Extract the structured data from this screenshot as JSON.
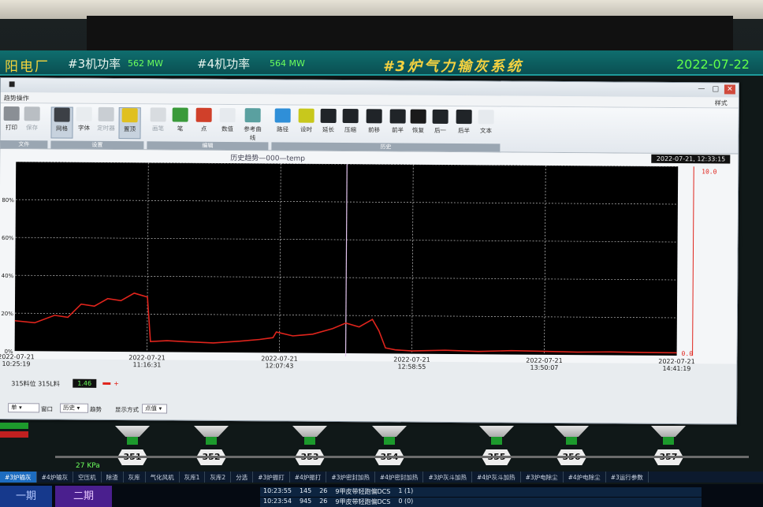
{
  "header": {
    "plant": "阳电厂",
    "unit3_label": "#3机功率",
    "unit3_value": "562 MW",
    "unit4_label": "#4机功率",
    "unit4_value": "564 MW",
    "system_title": "#3炉气力输灰系统",
    "date": "2022-07-22"
  },
  "window": {
    "menu": "趋势操作",
    "style_menu": "样式",
    "ribbon": {
      "buttons": [
        {
          "label": "打印",
          "name": "print",
          "dim": false
        },
        {
          "label": "保存",
          "name": "save",
          "dim": true
        },
        {
          "label": "网格",
          "name": "grid",
          "active": true
        },
        {
          "label": "字体",
          "name": "font"
        },
        {
          "label": "定时器",
          "name": "timer",
          "dim": true
        },
        {
          "label": "置顶",
          "name": "topmost",
          "active": true
        },
        {
          "label": "画笔",
          "name": "pen",
          "dim": true
        },
        {
          "label": "笔",
          "name": "pen2"
        },
        {
          "label": "点",
          "name": "point"
        },
        {
          "label": "数值",
          "name": "value"
        },
        {
          "label": "参考曲线",
          "name": "ref-curve"
        },
        {
          "label": "路径",
          "name": "path"
        },
        {
          "label": "设时",
          "name": "set-time"
        },
        {
          "label": "延长",
          "name": "extend"
        },
        {
          "label": "压缩",
          "name": "compress"
        },
        {
          "label": "前移",
          "name": "move-first"
        },
        {
          "label": "前半",
          "name": "prev-half"
        },
        {
          "label": "恢复",
          "name": "restore"
        },
        {
          "label": "后一",
          "name": "next-one"
        },
        {
          "label": "后半",
          "name": "next-half"
        },
        {
          "label": "文本",
          "name": "text"
        }
      ],
      "groups": [
        "文件",
        "设置",
        "编辑",
        "历史"
      ]
    },
    "chart_title": "历史趋势—000—temp",
    "timestamp": "2022-07-21, 12:33:15",
    "legend_text": "315料位 315L料",
    "legend_value": "1.46",
    "legend_marker": "+",
    "bottom": {
      "sel1": "单",
      "lbl1": "窗口",
      "sel2": "历史",
      "lbl2": "趋势",
      "lbl3": "显示方式",
      "sel3": "点值"
    }
  },
  "chart_data": {
    "type": "line",
    "ylim": [
      0,
      100
    ],
    "y_tick_labels": [
      "0%",
      "20%",
      "40%",
      "60%",
      "80%"
    ],
    "y_right_top": "10.0",
    "y_right_bottom": "0.0",
    "x_ticks": [
      {
        "date": "2022-07-21",
        "time": "10:25:19"
      },
      {
        "date": "2022-07-21",
        "time": "11:16:31"
      },
      {
        "date": "2022-07-21",
        "time": "12:07:43"
      },
      {
        "date": "2022-07-21",
        "time": "12:58:55"
      },
      {
        "date": "2022-07-21",
        "time": "13:50:07"
      },
      {
        "date": "2022-07-21",
        "time": "14:41:19"
      }
    ],
    "series": [
      {
        "color": "#e0241c",
        "x": [
          0,
          0.03,
          0.06,
          0.08,
          0.1,
          0.12,
          0.14,
          0.16,
          0.18,
          0.2,
          0.205,
          0.23,
          0.26,
          0.3,
          0.34,
          0.37,
          0.39,
          0.395,
          0.42,
          0.45,
          0.48,
          0.5,
          0.52,
          0.54,
          0.55,
          0.56,
          0.575,
          0.6,
          0.65,
          0.7,
          0.75,
          0.8,
          0.85,
          0.9,
          0.95,
          1.0
        ],
        "y": [
          16,
          15,
          19,
          18,
          25,
          24,
          28,
          27,
          31,
          29,
          5.5,
          6,
          5.5,
          5,
          6,
          7,
          8,
          11,
          9,
          10,
          13,
          16,
          14,
          18,
          12,
          3,
          2,
          1.5,
          2,
          1.5,
          2,
          1.8,
          1.5,
          1.7,
          1.5,
          1.5
        ]
      }
    ],
    "cursor_x": 0.5
  },
  "process": {
    "hoppers": [
      "351",
      "352",
      "353",
      "354",
      "355",
      "356",
      "357"
    ],
    "pressure": "27 KPa"
  },
  "tabs": [
    "#3炉输灰",
    "#4炉输灰",
    "空压机",
    "除渣",
    "灰库",
    "气化风机",
    "灰库1",
    "灰库2",
    "分选",
    "#3炉振打",
    "#4炉振打",
    "#3炉密封加热",
    "#4炉密封加热",
    "#3炉灰斗加热",
    "#4炉灰斗加热",
    "#3炉电除尘",
    "#4炉电除尘",
    "#3运行参数"
  ],
  "footer": {
    "phase1": "一期",
    "phase2": "二期",
    "log": [
      {
        "time": "10:23:55",
        "a": "145",
        "b": "26",
        "msg": "9甲皮带轻跑偏DCS",
        "v": "1 (1)"
      },
      {
        "time": "10:23:54",
        "a": "945",
        "b": "26",
        "msg": "9甲皮带轻跑偏DCS",
        "v": "0 (0)"
      }
    ]
  }
}
